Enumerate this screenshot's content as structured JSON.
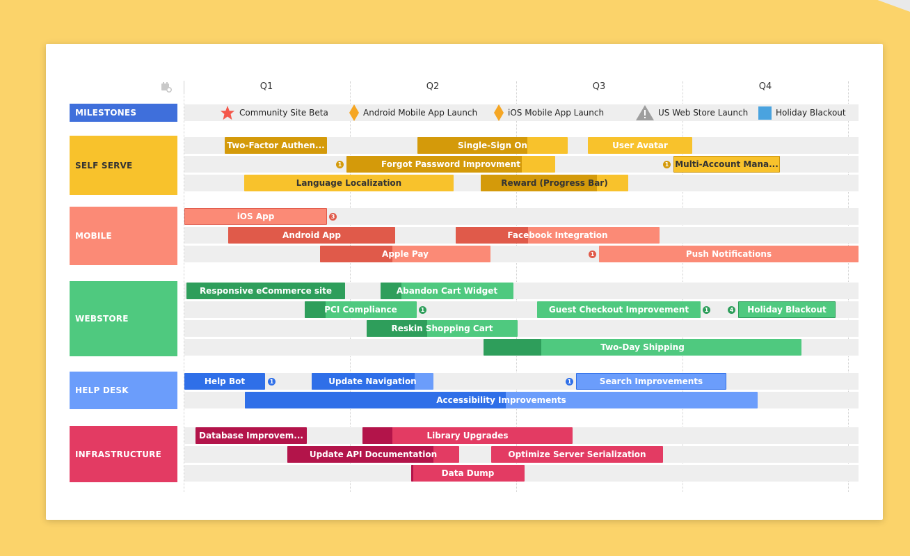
{
  "colors": {
    "background": "#fbd36a",
    "milestones": "#3f6fdb",
    "self_serve": "#f8c22c",
    "self_serve_dark": "#d49a0a",
    "mobile": "#fb8a76",
    "mobile_dark": "#e05a4a",
    "webstore": "#4fc97f",
    "webstore_dark": "#2e9e5b",
    "help_desk": "#6b9dfb",
    "help_desk_dark": "#2f6fe8",
    "infrastructure": "#e33b63",
    "infrastructure_dark": "#b3144a"
  },
  "header": {
    "settings_icon": "calendar-gear-icon",
    "quarters": [
      "Q1",
      "Q2",
      "Q3",
      "Q4"
    ]
  },
  "lanes": [
    "MILESTONES",
    "SELF SERVE",
    "MOBILE",
    "WEBSTORE",
    "HELP DESK",
    "INFRASTRUCTURE"
  ],
  "milestones": [
    {
      "label": "Community Site Beta",
      "icon": "star-icon"
    },
    {
      "label": "Android Mobile App Launch",
      "icon": "diamond-icon"
    },
    {
      "label": "iOS Mobile App Launch",
      "icon": "diamond-icon"
    },
    {
      "label": "US Web Store Launch",
      "icon": "warning-icon"
    },
    {
      "label": "Holiday Blackout",
      "icon": "square-icon"
    }
  ],
  "self_serve": {
    "two_factor": "Two-Factor Authen...",
    "single_sign_on": "Single-Sign On",
    "user_avatar": "User Avatar",
    "forgot_password": "Forgot Password Improvment",
    "forgot_password_badge": "1",
    "multi_account": "Multi-Account Mana...",
    "multi_account_badge": "1",
    "language_localization": "Language Localization",
    "reward": "Reward (Progress Bar)"
  },
  "mobile": {
    "ios_app": "iOS App",
    "ios_app_badge": "3",
    "android_app": "Android App",
    "facebook_integration": "Facebook Integration",
    "apple_pay": "Apple Pay",
    "push_notifications": "Push Notifications",
    "push_notifications_badge": "1"
  },
  "webstore": {
    "responsive": "Responsive eCommerce site",
    "abandon_cart": "Abandon Cart Widget",
    "pci": "PCI Compliance",
    "pci_badge": "1",
    "guest_checkout": "Guest Checkout Improvement",
    "guest_checkout_badge": "1",
    "holiday_blackout": "Holiday Blackout",
    "holiday_blackout_badge": "4",
    "reskin": "Reskin Shopping Cart",
    "two_day": "Two-Day Shipping"
  },
  "help_desk": {
    "help_bot": "Help Bot",
    "help_bot_badge": "1",
    "update_navigation": "Update Navigation",
    "search_improvements": "Search Improvements",
    "search_improvements_badge": "1",
    "accessibility": "Accessibility Improvements"
  },
  "infrastructure": {
    "database": "Database Improvem...",
    "library": "Library Upgrades",
    "update_api": "Update API Documentation",
    "optimize": "Optimize Server Serialization",
    "data_dump": "Data Dump"
  }
}
